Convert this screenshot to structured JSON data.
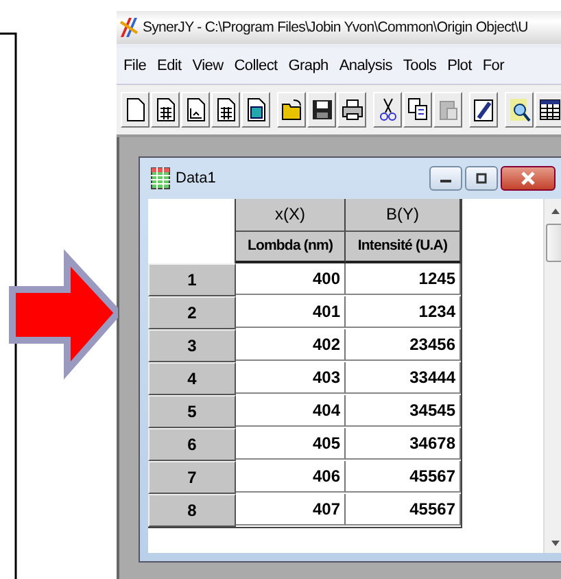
{
  "window": {
    "title": "SynerJY - C:\\Program Files\\Jobin Yvon\\Common\\Origin Object\\U"
  },
  "menu": [
    "File",
    "Edit",
    "View",
    "Collect",
    "Graph",
    "Analysis",
    "Tools",
    "Plot",
    "For"
  ],
  "worksheet": {
    "title": "Data1",
    "columns": [
      {
        "name": "x(X)",
        "label": "Lombda (nm)"
      },
      {
        "name": "B(Y)",
        "label": "Intensité (U.A)"
      }
    ],
    "rows": [
      {
        "number": "1",
        "values": [
          "400",
          "1245"
        ]
      },
      {
        "number": "2",
        "values": [
          "401",
          "1234"
        ]
      },
      {
        "number": "3",
        "values": [
          "402",
          "23456"
        ]
      },
      {
        "number": "4",
        "values": [
          "403",
          "33444"
        ]
      },
      {
        "number": "5",
        "values": [
          "404",
          "34545"
        ]
      },
      {
        "number": "6",
        "values": [
          "405",
          "34678"
        ]
      },
      {
        "number": "7",
        "values": [
          "406",
          "45567"
        ]
      },
      {
        "number": "8",
        "values": [
          "407",
          "45567"
        ]
      }
    ]
  }
}
